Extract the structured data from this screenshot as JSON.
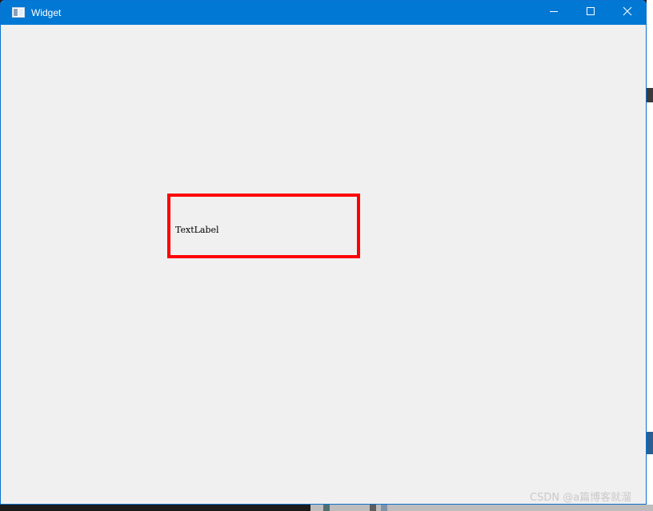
{
  "window": {
    "title": "Widget",
    "icon": "window-app-icon",
    "controls": {
      "minimize": "minimize-icon",
      "maximize": "maximize-icon",
      "close": "close-icon"
    },
    "accent": "#0078d4",
    "background": "#f0f0f0"
  },
  "content": {
    "text_label": "TextLabel",
    "highlight_color": "#ff0000"
  },
  "watermark": {
    "text": "CSDN @a篇博客就溜"
  }
}
